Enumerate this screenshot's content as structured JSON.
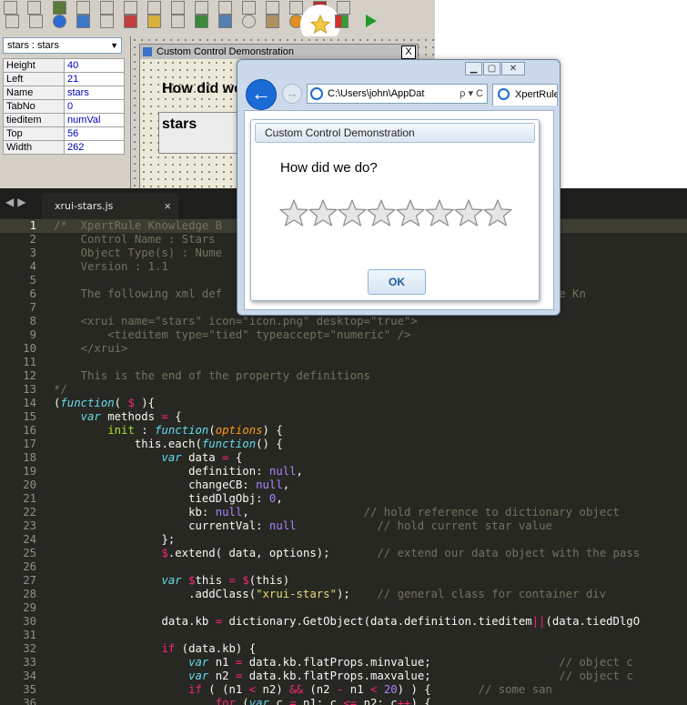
{
  "designer": {
    "object_select": "stars : stars",
    "properties": [
      {
        "key": "Height",
        "value": "40"
      },
      {
        "key": "Left",
        "value": "21"
      },
      {
        "key": "Name",
        "value": "stars"
      },
      {
        "key": "TabNo",
        "value": "0"
      },
      {
        "key": "tieditem",
        "value": "numVal"
      },
      {
        "key": "Top",
        "value": "56"
      },
      {
        "key": "Width",
        "value": "262"
      }
    ],
    "form_title": "Custom Control Demonstration",
    "form_close": "X",
    "form_heading": "How did we",
    "form_stars_label": "stars"
  },
  "browser": {
    "address": "C:\\Users\\john\\AppDat",
    "address_tools": "ρ ▾ C",
    "tab_label": "XpertRule",
    "dialog_title": "Custom Control Demonstration",
    "question": "How did we do?",
    "star_count": 8,
    "ok_label": "OK",
    "colors": {
      "star_fill": "#e6e6e6",
      "star_stroke": "#8c8c8c",
      "back_button": "#1b6bd6"
    }
  },
  "editor": {
    "tab_label": "xrui-stars.js",
    "tab_close": "×",
    "lines": [
      [
        [
          "c-com",
          "/*  XpertRule Knowledge B"
        ]
      ],
      [
        [
          "c-com",
          "    Control Name : Stars"
        ]
      ],
      [
        [
          "c-com",
          "    Object Type(s) : Nume"
        ]
      ],
      [
        [
          "c-com",
          "    Version : 1.1"
        ]
      ],
      [
        [
          "c-com",
          ""
        ]
      ],
      [
        [
          "c-com",
          "    The following xml def                                      the XpertRule Kn"
        ]
      ],
      [
        [
          "c-com",
          ""
        ]
      ],
      [
        [
          "c-com",
          "    <xrui name=\"stars\" icon=\"icon.png\" desktop=\"true\">"
        ]
      ],
      [
        [
          "c-com",
          "        <tieditem type=\"tied\" typeaccept=\"numeric\" />"
        ]
      ],
      [
        [
          "c-com",
          "    </xrui>"
        ]
      ],
      [
        [
          "c-com",
          ""
        ]
      ],
      [
        [
          "c-com",
          "    This is the end of the property definitions"
        ]
      ],
      [
        [
          "c-com",
          "*/"
        ]
      ],
      [
        [
          "",
          "("
        ],
        [
          "c-kw",
          "function"
        ],
        [
          "",
          "( "
        ],
        [
          "c-op",
          "$"
        ],
        [
          "",
          " ){"
        ]
      ],
      [
        [
          "",
          "    "
        ],
        [
          "c-kw",
          "var"
        ],
        [
          "",
          " methods "
        ],
        [
          "c-op",
          "="
        ],
        [
          "",
          " {"
        ]
      ],
      [
        [
          "",
          "        "
        ],
        [
          "c-fn",
          "init"
        ],
        [
          "",
          " : "
        ],
        [
          "c-kw",
          "function"
        ],
        [
          "",
          "("
        ],
        [
          "c-arg",
          "options"
        ],
        [
          "",
          ") {"
        ]
      ],
      [
        [
          "",
          "            this.each("
        ],
        [
          "c-kw",
          "function"
        ],
        [
          "",
          "() {"
        ]
      ],
      [
        [
          "",
          "                "
        ],
        [
          "c-kw",
          "var"
        ],
        [
          "",
          " data "
        ],
        [
          "c-op",
          "="
        ],
        [
          "",
          " {"
        ]
      ],
      [
        [
          "",
          "                    definition: "
        ],
        [
          "c-num",
          "null"
        ],
        [
          "",
          ","
        ]
      ],
      [
        [
          "",
          "                    changeCB: "
        ],
        [
          "c-num",
          "null"
        ],
        [
          "",
          ","
        ]
      ],
      [
        [
          "",
          "                    tiedDlgObj: "
        ],
        [
          "c-num",
          "0"
        ],
        [
          "",
          ","
        ]
      ],
      [
        [
          "",
          "                    kb: "
        ],
        [
          "c-num",
          "null"
        ],
        [
          "",
          ",                 "
        ],
        [
          "c-com",
          "// hold reference to dictionary object"
        ]
      ],
      [
        [
          "",
          "                    currentVal: "
        ],
        [
          "c-num",
          "null"
        ],
        [
          "",
          "            "
        ],
        [
          "c-com",
          "// hold current star value"
        ]
      ],
      [
        [
          "",
          "                };"
        ]
      ],
      [
        [
          "",
          "                "
        ],
        [
          "c-op",
          "$"
        ],
        [
          "",
          ".extend( data, options);       "
        ],
        [
          "c-com",
          "// extend our data object with the pass"
        ]
      ],
      [
        [
          "",
          ""
        ]
      ],
      [
        [
          "",
          "                "
        ],
        [
          "c-kw",
          "var"
        ],
        [
          "",
          " "
        ],
        [
          "c-op",
          "$"
        ],
        [
          "",
          "this "
        ],
        [
          "c-op",
          "="
        ],
        [
          "",
          " "
        ],
        [
          "c-op",
          "$"
        ],
        [
          "",
          "(this)"
        ]
      ],
      [
        [
          "",
          "                    .addClass("
        ],
        [
          "c-str",
          "\"xrui-stars\""
        ],
        [
          "",
          ");    "
        ],
        [
          "c-com",
          "// general class for container div"
        ]
      ],
      [
        [
          "",
          ""
        ]
      ],
      [
        [
          "",
          "                data.kb "
        ],
        [
          "c-op",
          "="
        ],
        [
          "",
          " dictionary.GetObject(data.definition.tieditem"
        ],
        [
          "c-op",
          "||"
        ],
        [
          "",
          "(data.tiedDlgO"
        ]
      ],
      [
        [
          "",
          ""
        ]
      ],
      [
        [
          "",
          "                "
        ],
        [
          "c-op",
          "if"
        ],
        [
          "",
          " (data.kb) {"
        ]
      ],
      [
        [
          "",
          "                    "
        ],
        [
          "c-kw",
          "var"
        ],
        [
          "",
          " n1 "
        ],
        [
          "c-op",
          "="
        ],
        [
          "",
          " data.kb.flatProps.minvalue;                   "
        ],
        [
          "c-com",
          "// object c"
        ]
      ],
      [
        [
          "",
          "                    "
        ],
        [
          "c-kw",
          "var"
        ],
        [
          "",
          " n2 "
        ],
        [
          "c-op",
          "="
        ],
        [
          "",
          " data.kb.flatProps.maxvalue;                   "
        ],
        [
          "c-com",
          "// object c"
        ]
      ],
      [
        [
          "",
          "                    "
        ],
        [
          "c-op",
          "if"
        ],
        [
          "",
          " ( (n1 "
        ],
        [
          "c-op",
          "<"
        ],
        [
          "",
          " n2) "
        ],
        [
          "c-op",
          "&&"
        ],
        [
          "",
          " (n2 "
        ],
        [
          "c-op",
          "-"
        ],
        [
          "",
          " n1 "
        ],
        [
          "c-op",
          "<"
        ],
        [
          "",
          " "
        ],
        [
          "c-num",
          "20"
        ],
        [
          "",
          ") ) {       "
        ],
        [
          "c-com",
          "// some san"
        ]
      ],
      [
        [
          "",
          "                        "
        ],
        [
          "c-op",
          "for"
        ],
        [
          "",
          " ("
        ],
        [
          "c-kw",
          "var"
        ],
        [
          "",
          " c "
        ],
        [
          "c-op",
          "="
        ],
        [
          "",
          " n1; c "
        ],
        [
          "c-op",
          "<="
        ],
        [
          "",
          " n2; c"
        ],
        [
          "c-op",
          "++"
        ],
        [
          "",
          ") {"
        ]
      ]
    ]
  }
}
